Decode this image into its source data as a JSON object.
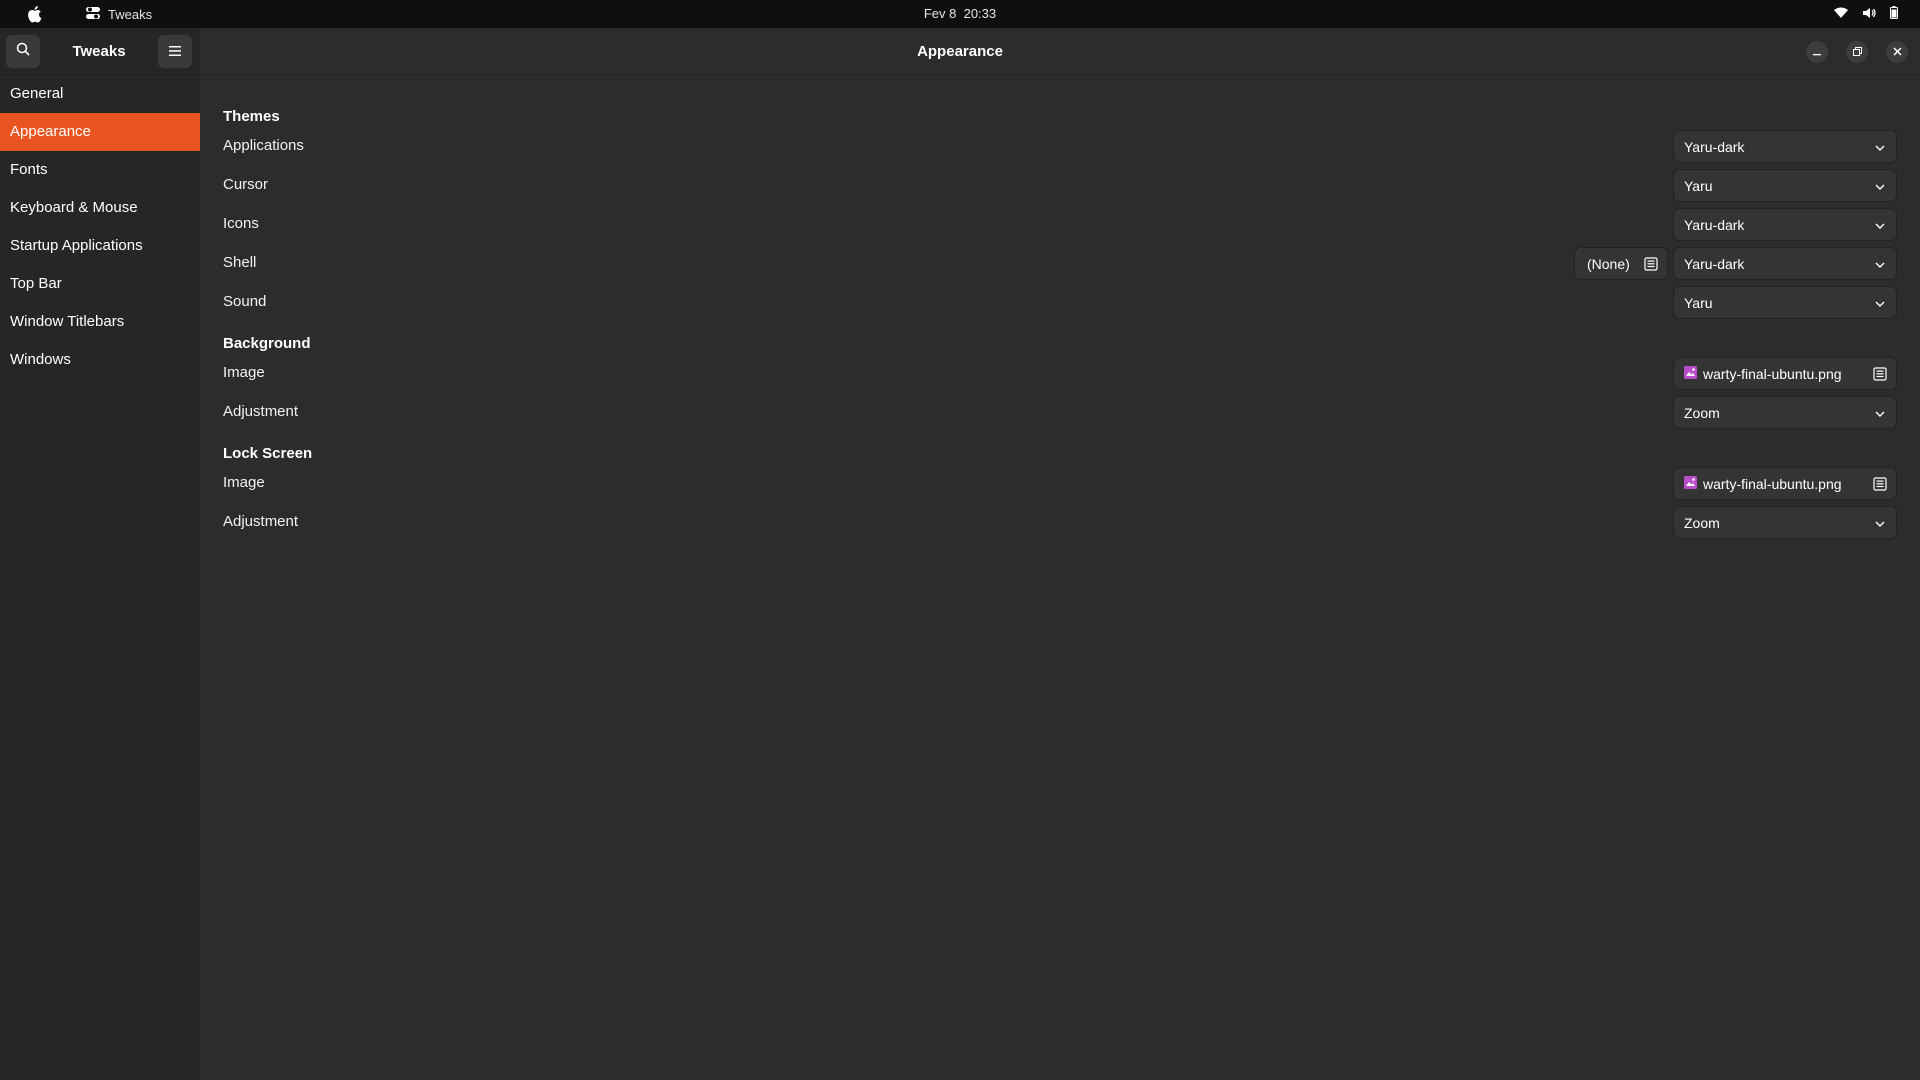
{
  "system_bar": {
    "app_name": "Tweaks",
    "date": "Fev 8",
    "time": "20:33"
  },
  "sidebar": {
    "title": "Tweaks",
    "items": [
      {
        "label": "General",
        "active": false
      },
      {
        "label": "Appearance",
        "active": true
      },
      {
        "label": "Fonts",
        "active": false
      },
      {
        "label": "Keyboard & Mouse",
        "active": false
      },
      {
        "label": "Startup Applications",
        "active": false
      },
      {
        "label": "Top Bar",
        "active": false
      },
      {
        "label": "Window Titlebars",
        "active": false
      },
      {
        "label": "Windows",
        "active": false
      }
    ]
  },
  "content": {
    "title": "Appearance",
    "themes": {
      "section": "Themes",
      "applications": {
        "label": "Applications",
        "value": "Yaru-dark"
      },
      "cursor": {
        "label": "Cursor",
        "value": "Yaru"
      },
      "icons": {
        "label": "Icons",
        "value": "Yaru-dark"
      },
      "shell": {
        "label": "Shell",
        "value": "Yaru-dark",
        "file_value": "(None)"
      },
      "sound": {
        "label": "Sound",
        "value": "Yaru"
      }
    },
    "background": {
      "section": "Background",
      "image": {
        "label": "Image",
        "value": "warty-final-ubuntu.png"
      },
      "adjustment": {
        "label": "Adjustment",
        "value": "Zoom"
      }
    },
    "lock_screen": {
      "section": "Lock Screen",
      "image": {
        "label": "Image",
        "value": "warty-final-ubuntu.png"
      },
      "adjustment": {
        "label": "Adjustment",
        "value": "Zoom"
      }
    }
  },
  "colors": {
    "accent": "#e95420",
    "sidebar_bg": "#262626",
    "content_bg": "#2c2c2c",
    "topbar_bg": "#0f0f0f"
  }
}
